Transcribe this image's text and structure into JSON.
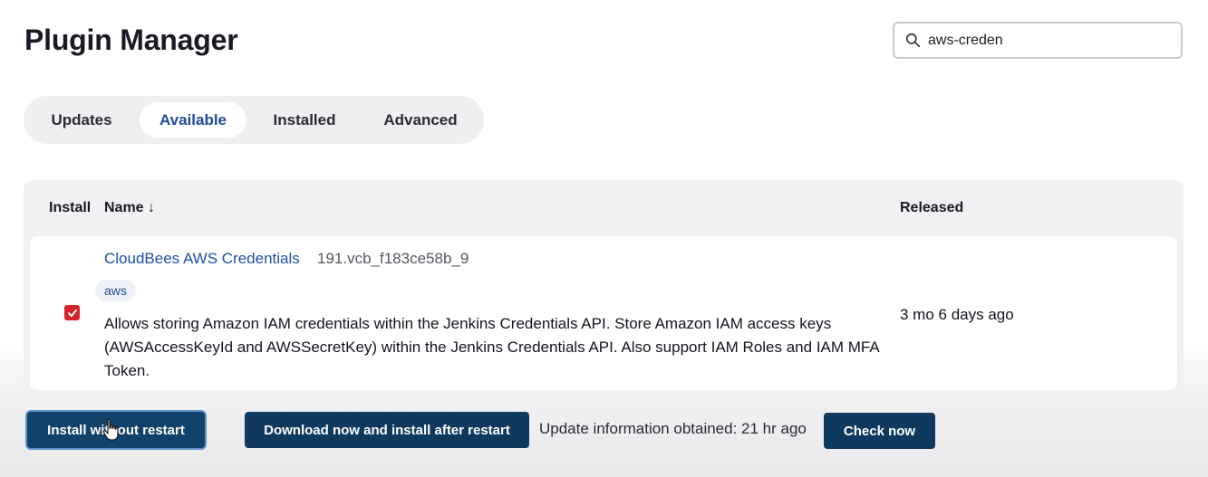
{
  "header": {
    "title": "Plugin Manager",
    "search_value": "aws-creden"
  },
  "tabs": [
    {
      "label": "Updates",
      "active": false
    },
    {
      "label": "Available",
      "active": true
    },
    {
      "label": "Installed",
      "active": false
    },
    {
      "label": "Advanced",
      "active": false
    }
  ],
  "table": {
    "columns": {
      "install": "Install",
      "name": "Name ↓",
      "released": "Released"
    },
    "rows": [
      {
        "checked": true,
        "name": "CloudBees AWS Credentials",
        "version": "191.vcb_f183ce58b_9",
        "tag": "aws",
        "description": "Allows storing Amazon IAM credentials within the Jenkins Credentials API. Store Amazon IAM access keys (AWSAccessKeyId and AWSSecretKey) within the Jenkins Credentials API. Also support IAM Roles and IAM MFA Token.",
        "released": "3 mo 6 days ago"
      }
    ]
  },
  "footer": {
    "install_without_restart": "Install without restart",
    "download_install_after_restart": "Download now and install after restart",
    "update_info": "Update information obtained: 21 hr ago",
    "check_now": "Check now"
  },
  "colors": {
    "link": "#1e4fa8",
    "primary_button": "#0f3a5e",
    "checkbox": "#d4242c"
  }
}
